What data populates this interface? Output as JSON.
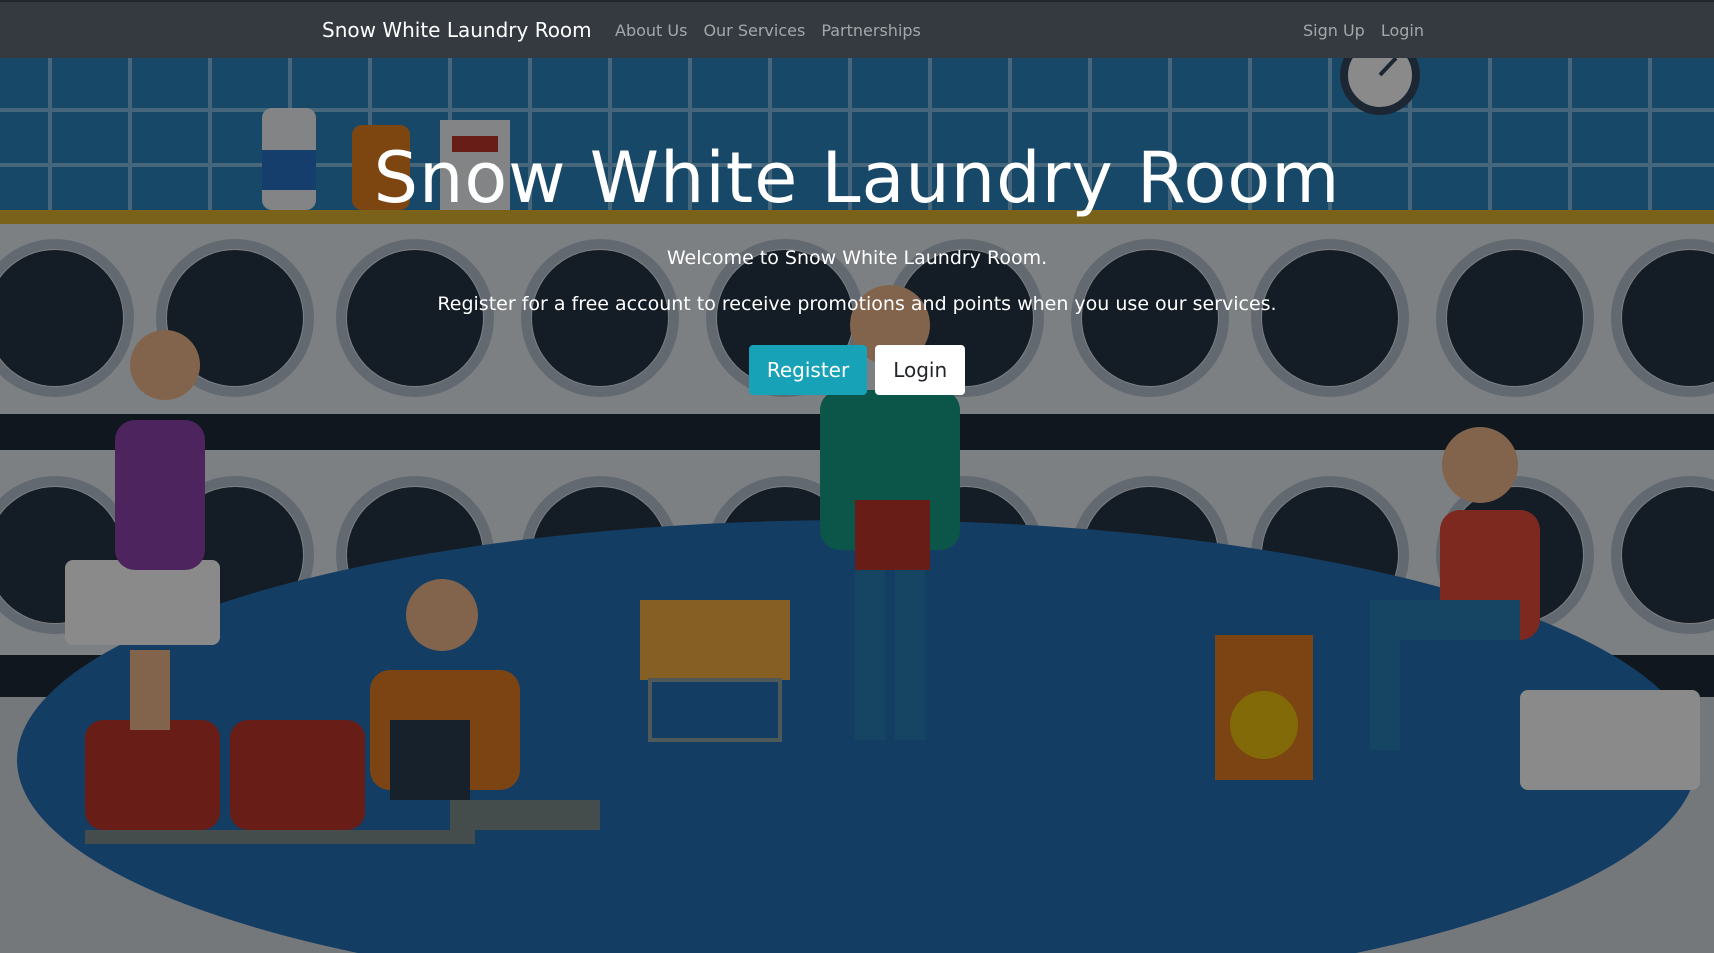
{
  "navbar": {
    "brand": "Snow White Laundry Room",
    "links_left": [
      {
        "label": "About Us"
      },
      {
        "label": "Our Services"
      },
      {
        "label": "Partnerships"
      }
    ],
    "links_right": [
      {
        "label": "Sign Up"
      },
      {
        "label": "Login"
      }
    ]
  },
  "hero": {
    "title": "Snow White Laundry Room",
    "welcome": "Welcome to Snow White Laundry Room.",
    "subtitle": "Register for a free account to receive promotions and points when you use our services.",
    "register_label": "Register",
    "login_label": "Login"
  },
  "colors": {
    "navbar_bg": "#343a40",
    "register_button": "#17a2b8",
    "login_button": "#ffffff",
    "wall": "#2e86c1",
    "washer": "#eef1f4"
  }
}
